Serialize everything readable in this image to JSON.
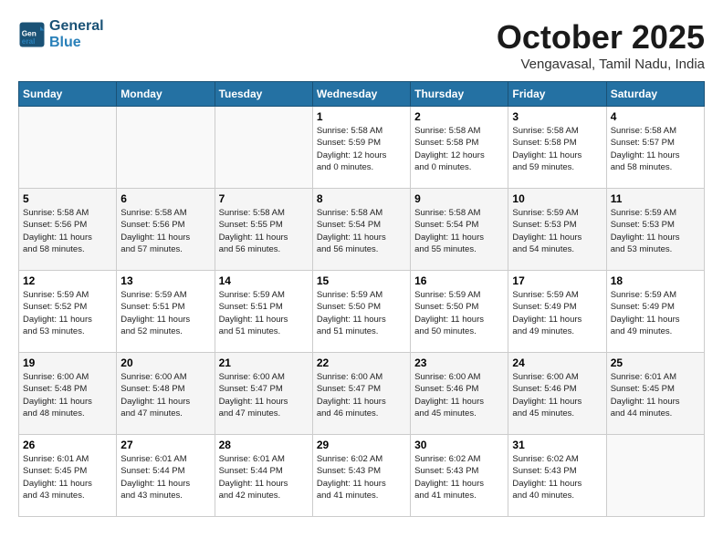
{
  "header": {
    "logo_line1": "General",
    "logo_line2": "Blue",
    "month": "October 2025",
    "location": "Vengavasal, Tamil Nadu, India"
  },
  "weekdays": [
    "Sunday",
    "Monday",
    "Tuesday",
    "Wednesday",
    "Thursday",
    "Friday",
    "Saturday"
  ],
  "weeks": [
    [
      {
        "day": "",
        "info": ""
      },
      {
        "day": "",
        "info": ""
      },
      {
        "day": "",
        "info": ""
      },
      {
        "day": "1",
        "info": "Sunrise: 5:58 AM\nSunset: 5:59 PM\nDaylight: 12 hours\nand 0 minutes."
      },
      {
        "day": "2",
        "info": "Sunrise: 5:58 AM\nSunset: 5:58 PM\nDaylight: 12 hours\nand 0 minutes."
      },
      {
        "day": "3",
        "info": "Sunrise: 5:58 AM\nSunset: 5:58 PM\nDaylight: 11 hours\nand 59 minutes."
      },
      {
        "day": "4",
        "info": "Sunrise: 5:58 AM\nSunset: 5:57 PM\nDaylight: 11 hours\nand 58 minutes."
      }
    ],
    [
      {
        "day": "5",
        "info": "Sunrise: 5:58 AM\nSunset: 5:56 PM\nDaylight: 11 hours\nand 58 minutes."
      },
      {
        "day": "6",
        "info": "Sunrise: 5:58 AM\nSunset: 5:56 PM\nDaylight: 11 hours\nand 57 minutes."
      },
      {
        "day": "7",
        "info": "Sunrise: 5:58 AM\nSunset: 5:55 PM\nDaylight: 11 hours\nand 56 minutes."
      },
      {
        "day": "8",
        "info": "Sunrise: 5:58 AM\nSunset: 5:54 PM\nDaylight: 11 hours\nand 56 minutes."
      },
      {
        "day": "9",
        "info": "Sunrise: 5:58 AM\nSunset: 5:54 PM\nDaylight: 11 hours\nand 55 minutes."
      },
      {
        "day": "10",
        "info": "Sunrise: 5:59 AM\nSunset: 5:53 PM\nDaylight: 11 hours\nand 54 minutes."
      },
      {
        "day": "11",
        "info": "Sunrise: 5:59 AM\nSunset: 5:53 PM\nDaylight: 11 hours\nand 53 minutes."
      }
    ],
    [
      {
        "day": "12",
        "info": "Sunrise: 5:59 AM\nSunset: 5:52 PM\nDaylight: 11 hours\nand 53 minutes."
      },
      {
        "day": "13",
        "info": "Sunrise: 5:59 AM\nSunset: 5:51 PM\nDaylight: 11 hours\nand 52 minutes."
      },
      {
        "day": "14",
        "info": "Sunrise: 5:59 AM\nSunset: 5:51 PM\nDaylight: 11 hours\nand 51 minutes."
      },
      {
        "day": "15",
        "info": "Sunrise: 5:59 AM\nSunset: 5:50 PM\nDaylight: 11 hours\nand 51 minutes."
      },
      {
        "day": "16",
        "info": "Sunrise: 5:59 AM\nSunset: 5:50 PM\nDaylight: 11 hours\nand 50 minutes."
      },
      {
        "day": "17",
        "info": "Sunrise: 5:59 AM\nSunset: 5:49 PM\nDaylight: 11 hours\nand 49 minutes."
      },
      {
        "day": "18",
        "info": "Sunrise: 5:59 AM\nSunset: 5:49 PM\nDaylight: 11 hours\nand 49 minutes."
      }
    ],
    [
      {
        "day": "19",
        "info": "Sunrise: 6:00 AM\nSunset: 5:48 PM\nDaylight: 11 hours\nand 48 minutes."
      },
      {
        "day": "20",
        "info": "Sunrise: 6:00 AM\nSunset: 5:48 PM\nDaylight: 11 hours\nand 47 minutes."
      },
      {
        "day": "21",
        "info": "Sunrise: 6:00 AM\nSunset: 5:47 PM\nDaylight: 11 hours\nand 47 minutes."
      },
      {
        "day": "22",
        "info": "Sunrise: 6:00 AM\nSunset: 5:47 PM\nDaylight: 11 hours\nand 46 minutes."
      },
      {
        "day": "23",
        "info": "Sunrise: 6:00 AM\nSunset: 5:46 PM\nDaylight: 11 hours\nand 45 minutes."
      },
      {
        "day": "24",
        "info": "Sunrise: 6:00 AM\nSunset: 5:46 PM\nDaylight: 11 hours\nand 45 minutes."
      },
      {
        "day": "25",
        "info": "Sunrise: 6:01 AM\nSunset: 5:45 PM\nDaylight: 11 hours\nand 44 minutes."
      }
    ],
    [
      {
        "day": "26",
        "info": "Sunrise: 6:01 AM\nSunset: 5:45 PM\nDaylight: 11 hours\nand 43 minutes."
      },
      {
        "day": "27",
        "info": "Sunrise: 6:01 AM\nSunset: 5:44 PM\nDaylight: 11 hours\nand 43 minutes."
      },
      {
        "day": "28",
        "info": "Sunrise: 6:01 AM\nSunset: 5:44 PM\nDaylight: 11 hours\nand 42 minutes."
      },
      {
        "day": "29",
        "info": "Sunrise: 6:02 AM\nSunset: 5:43 PM\nDaylight: 11 hours\nand 41 minutes."
      },
      {
        "day": "30",
        "info": "Sunrise: 6:02 AM\nSunset: 5:43 PM\nDaylight: 11 hours\nand 41 minutes."
      },
      {
        "day": "31",
        "info": "Sunrise: 6:02 AM\nSunset: 5:43 PM\nDaylight: 11 hours\nand 40 minutes."
      },
      {
        "day": "",
        "info": ""
      }
    ]
  ]
}
